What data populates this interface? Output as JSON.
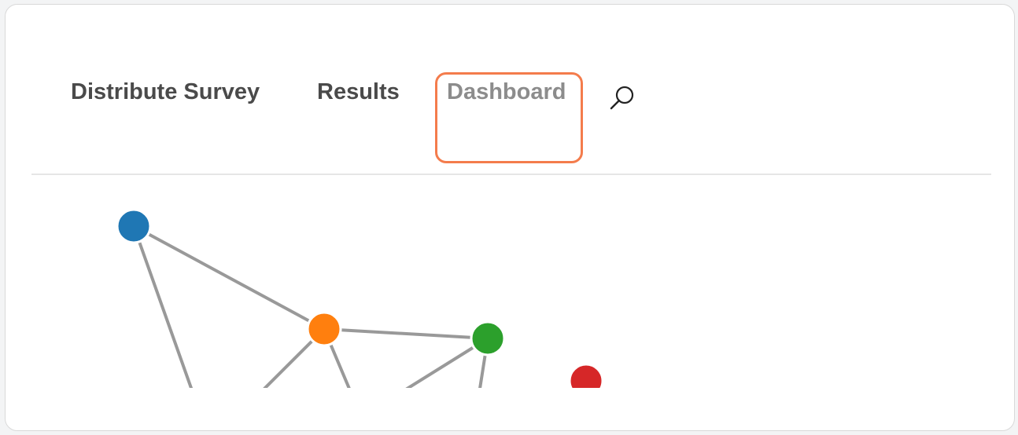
{
  "nav": {
    "items": [
      {
        "label": "Distribute Survey"
      },
      {
        "label": "Results"
      },
      {
        "label": "Dashboard",
        "highlighted": true
      }
    ],
    "search_icon": "search-icon"
  },
  "colors": {
    "highlight_border": "#f47c4c",
    "node_blue": "#1f77b4",
    "node_orange": "#ff7f0e",
    "node_green": "#2ca02c",
    "node_red": "#d62728",
    "edge": "#999999"
  },
  "network": {
    "nodes": [
      {
        "id": "blue",
        "color": "#1f77b4"
      },
      {
        "id": "orange",
        "color": "#ff7f0e"
      },
      {
        "id": "green",
        "color": "#2ca02c"
      },
      {
        "id": "red",
        "color": "#d62728"
      }
    ],
    "edges": [
      [
        "blue",
        "orange"
      ],
      [
        "orange",
        "green"
      ]
    ]
  }
}
